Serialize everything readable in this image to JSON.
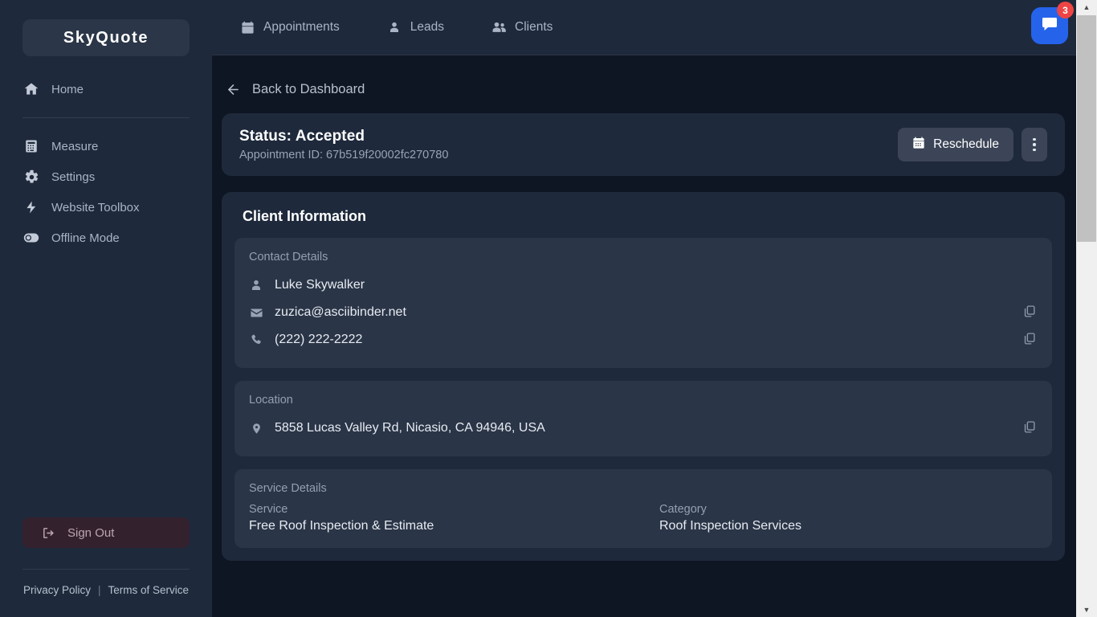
{
  "sidebar": {
    "logo": "SkyQuote",
    "primary_items": [
      {
        "label": "Home",
        "icon": "home-icon"
      }
    ],
    "items": [
      {
        "label": "Measure",
        "icon": "calculator-icon"
      },
      {
        "label": "Settings",
        "icon": "gear-icon"
      },
      {
        "label": "Website Toolbox",
        "icon": "bolt-icon"
      },
      {
        "label": "Offline Mode",
        "icon": "toggle-off-icon"
      }
    ],
    "sign_out": "Sign Out",
    "footer": {
      "privacy": "Privacy Policy",
      "separator": "|",
      "terms": "Terms of Service"
    }
  },
  "topbar": {
    "nav": [
      {
        "label": "Appointments",
        "icon": "calendar-icon"
      },
      {
        "label": "Leads",
        "icon": "user-icon"
      },
      {
        "label": "Clients",
        "icon": "users-icon"
      }
    ],
    "chat": {
      "icon": "chat-bubble-icon",
      "badge": "3"
    }
  },
  "page": {
    "back_label": "Back to Dashboard",
    "status": {
      "title": "Status: Accepted",
      "appointment_id": "Appointment ID: 67b519f20002fc270780",
      "reschedule_label": "Reschedule",
      "menu_icon": "kebab-menu-icon"
    },
    "client_information": {
      "heading": "Client Information",
      "contact": {
        "label": "Contact Details",
        "name": "Luke Skywalker",
        "email": "zuzica@asciibinder.net",
        "phone": "(222) 222-2222"
      },
      "location": {
        "label": "Location",
        "address": "5858 Lucas Valley Rd, Nicasio, CA 94946, USA"
      },
      "service": {
        "label": "Service Details",
        "service_key": "Service",
        "service_value": "Free Roof Inspection & Estimate",
        "category_key": "Category",
        "category_value": "Roof Inspection Services"
      }
    }
  },
  "colors": {
    "sidebar_bg": "#1e293b",
    "main_bg": "#0f1623",
    "panel_bg": "#2a3547",
    "accent_blue": "#2563eb",
    "badge_red": "#ef4444",
    "signout_bg": "#34212e"
  }
}
